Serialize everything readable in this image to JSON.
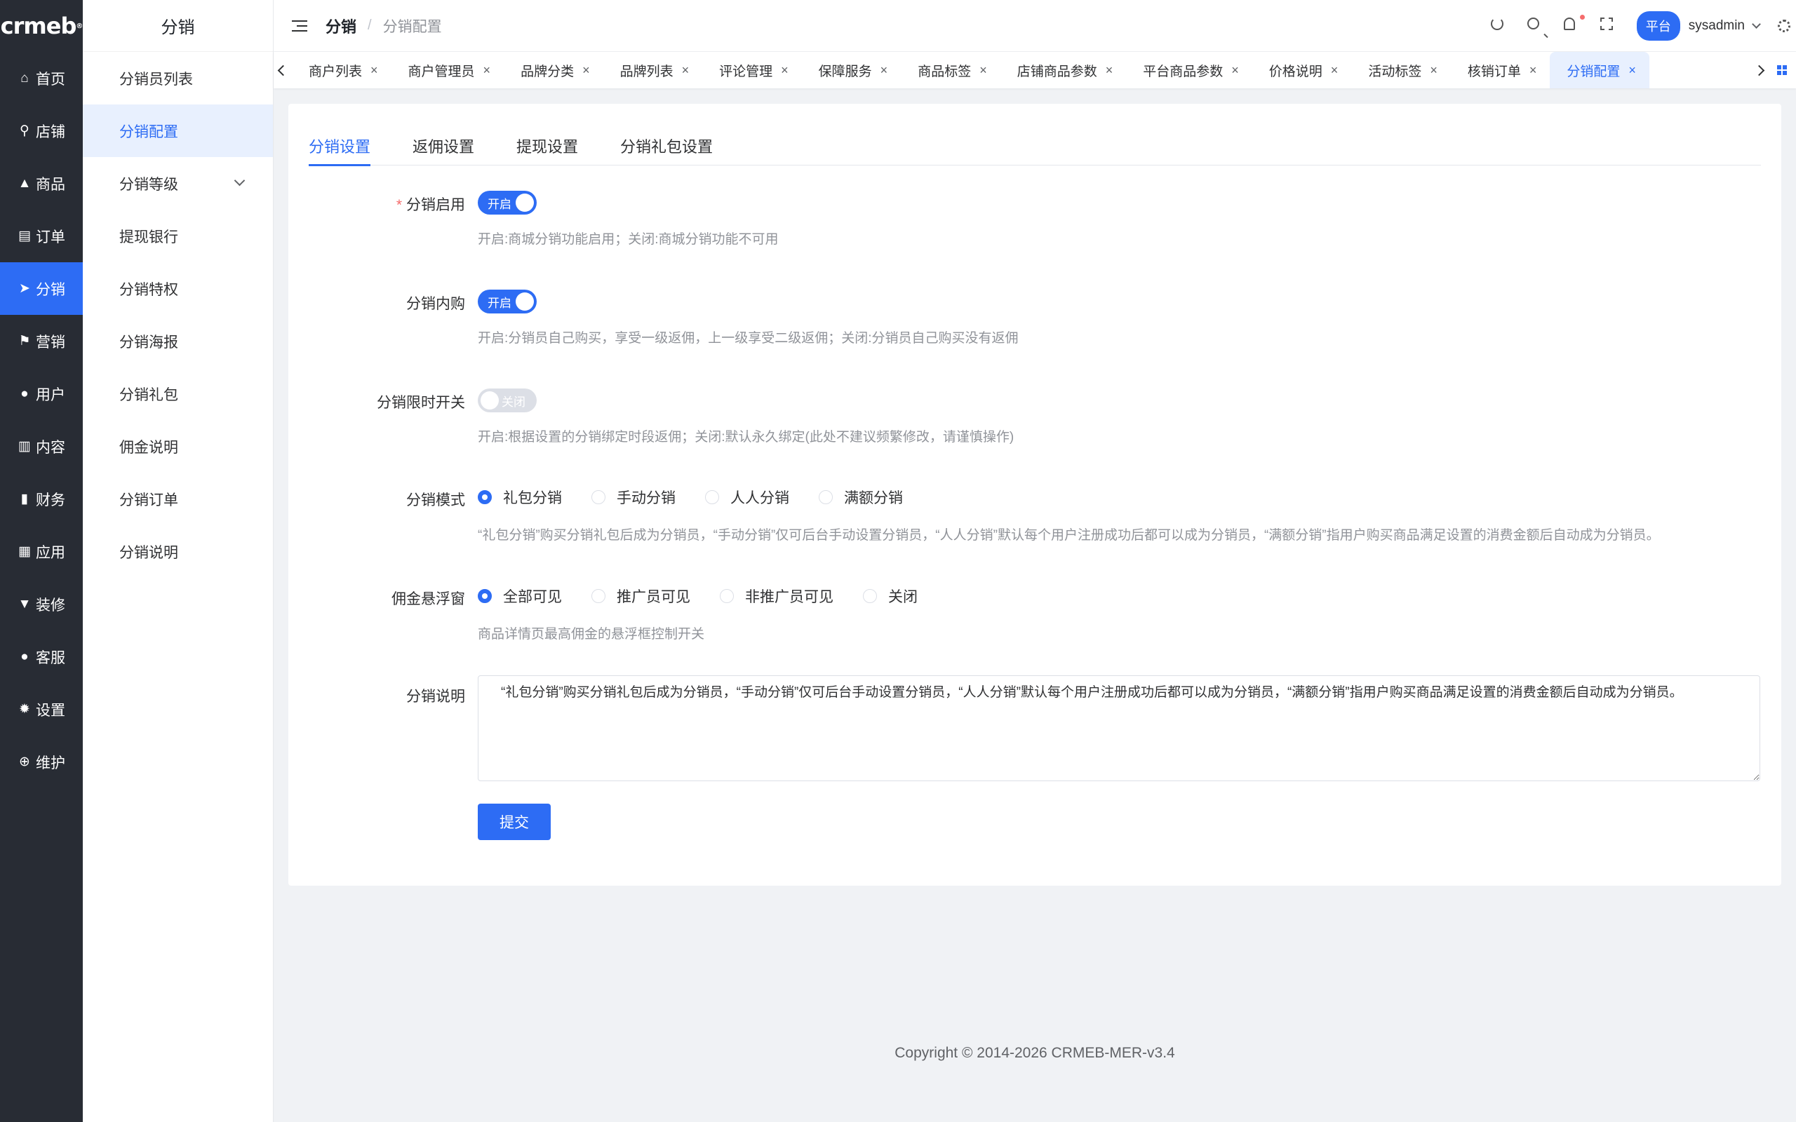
{
  "logo": "crmeb",
  "rail": [
    {
      "icon": "home-icon",
      "glyph": "⌂",
      "label": "首页"
    },
    {
      "icon": "store-icon",
      "glyph": "⚲",
      "label": "店铺"
    },
    {
      "icon": "bag-icon",
      "glyph": "▲",
      "label": "商品"
    },
    {
      "icon": "clipboard-icon",
      "glyph": "▤",
      "label": "订单"
    },
    {
      "icon": "send-icon",
      "glyph": "➤",
      "label": "分销"
    },
    {
      "icon": "flag-icon",
      "glyph": "⚑",
      "label": "营销"
    },
    {
      "icon": "user-icon",
      "glyph": "●",
      "label": "用户"
    },
    {
      "icon": "book-icon",
      "glyph": "▥",
      "label": "内容"
    },
    {
      "icon": "bar-chart-icon",
      "glyph": "▮",
      "label": "财务"
    },
    {
      "icon": "apps-icon",
      "glyph": "▦",
      "label": "应用"
    },
    {
      "icon": "brush-icon",
      "glyph": "▼",
      "label": "装修"
    },
    {
      "icon": "service-icon",
      "glyph": "●",
      "label": "客服"
    },
    {
      "icon": "gear-icon",
      "glyph": "✹",
      "label": "设置"
    },
    {
      "icon": "plus-circle-icon",
      "glyph": "⊕",
      "label": "维护"
    }
  ],
  "subnav": {
    "title": "分销",
    "items": [
      "分销员列表",
      "分销配置",
      "分销等级",
      "提现银行",
      "分销特权",
      "分销海报",
      "分销礼包",
      "佣金说明",
      "分销订单",
      "分销说明"
    ]
  },
  "header": {
    "crumb_main": "分销",
    "crumb_sep": "/",
    "crumb_sub": "分销配置",
    "platform": "平台",
    "user": "sysadmin"
  },
  "tabs": [
    "商户列表",
    "商户管理员",
    "品牌分类",
    "品牌列表",
    "评论管理",
    "保障服务",
    "商品标签",
    "店铺商品参数",
    "平台商品参数",
    "价格说明",
    "活动标签",
    "核销订单",
    "分销配置"
  ],
  "form": {
    "tabs": [
      "分销设置",
      "返佣设置",
      "提现设置",
      "分销礼包设置"
    ],
    "enable": {
      "required": "*",
      "label": "分销启用",
      "switch": "开启",
      "hint": "开启:商城分销功能启用；关闭:商城分销功能不可用"
    },
    "self_buy": {
      "label": "分销内购",
      "switch": "开启",
      "hint": "开启:分销员自己购买，享受一级返佣，上一级享受二级返佣；关闭:分销员自己购买没有返佣"
    },
    "time_limit": {
      "label": "分销限时开关",
      "switch": "关闭",
      "hint": "开启:根据设置的分销绑定时段返佣；关闭:默认永久绑定(此处不建议频繁修改，请谨慎操作)"
    },
    "mode": {
      "label": "分销模式",
      "options": [
        "礼包分销",
        "手动分销",
        "人人分销",
        "满额分销"
      ],
      "hint": "“礼包分销”购买分销礼包后成为分销员，“手动分销”仅可后台手动设置分销员，“人人分销”默认每个用户注册成功后都可以成为分销员，“满额分销”指用户购买商品满足设置的消费金额后自动成为分销员。"
    },
    "float_window": {
      "label": "佣金悬浮窗",
      "options": [
        "全部可见",
        "推广员可见",
        "非推广员可见",
        "关闭"
      ],
      "hint": "商品详情页最高佣金的悬浮框控制开关"
    },
    "description": {
      "label": "分销说明",
      "value": "“礼包分销”购买分销礼包后成为分销员，“手动分销”仅可后台手动设置分销员，“人人分销”默认每个用户注册成功后都可以成为分销员，“满额分销”指用户购买商品满足设置的消费金额后自动成为分销员。"
    },
    "submit": "提交"
  },
  "footer": "Copyright © 2014-2026 CRMEB-MER-v3.4",
  "colors": {
    "accent": "#2d6cf4",
    "rail_bg": "#282c34"
  }
}
